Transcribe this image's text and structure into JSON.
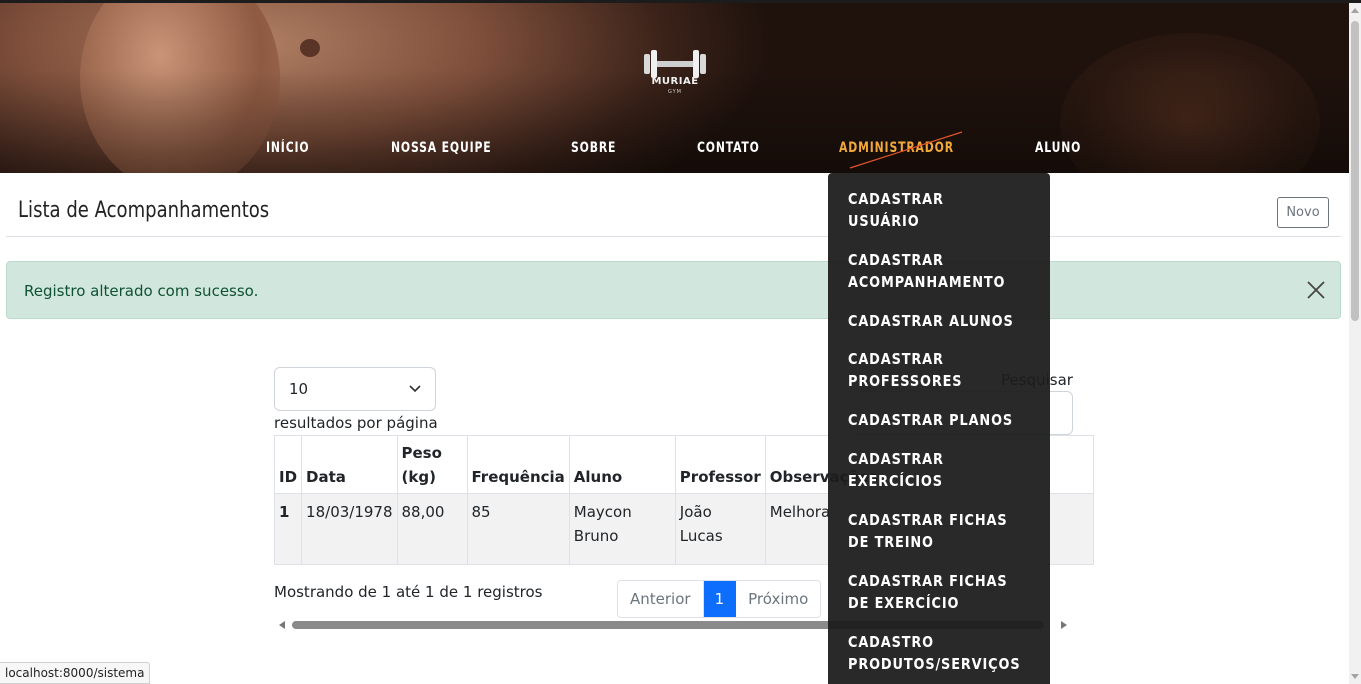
{
  "brand": {
    "name": "MURIAÉ",
    "tagline": "GYM"
  },
  "nav": {
    "items": [
      "INÍCIO",
      "NOSSA EQUIPE",
      "SOBRE",
      "CONTATO",
      "ADMINISTRADOR",
      "ALUNO"
    ],
    "active": "ADMINISTRADOR",
    "active_color": "#f2a93b"
  },
  "dropdown": {
    "items": [
      "CADASTRAR\nUSUÁRIO",
      "CADASTRAR\nACOMPANHAMENTO",
      "CADASTRAR ALUNOS",
      "CADASTRAR\nPROFESSORES",
      "CADASTRAR PLANOS",
      "CADASTRAR\nEXERCÍCIOS",
      "CADASTRAR FICHAS\nDE TREINO",
      "CADASTRAR FICHAS\nDE EXERCÍCIO",
      "CADASTRO\nPRODUTOS/SERVIÇOS"
    ]
  },
  "page": {
    "title": "Lista de Acompanhamentos",
    "new_button": "Novo"
  },
  "alert": {
    "message": "Registro alterado com sucesso.",
    "type": "success"
  },
  "datatable": {
    "page_length": "10",
    "page_length_label": "resultados por página",
    "search_label": "Pesquisar",
    "search_value": "",
    "columns": [
      "ID",
      "Data",
      "Peso\n(kg)",
      "Frequência",
      "Aluno",
      "Professor",
      "Observações"
    ],
    "rows": [
      {
        "id": "1",
        "data": "18/03/1978",
        "peso": "88,00",
        "frequencia": "85",
        "aluno": "Maycon\nBruno",
        "professor": "João\nLucas",
        "observacoes": "Melhora"
      }
    ],
    "info": "Mostrando de 1 até 1 de 1 registros",
    "pagination": {
      "previous": "Anterior",
      "current": "1",
      "next": "Próximo"
    }
  },
  "status_bar": {
    "url": "localhost:8000/sistema"
  },
  "colors": {
    "alert_bg": "#d1e7dd",
    "alert_text": "#0f5132",
    "pager_active": "#0d6efd",
    "dropdown_bg": "#1c1c1c"
  }
}
